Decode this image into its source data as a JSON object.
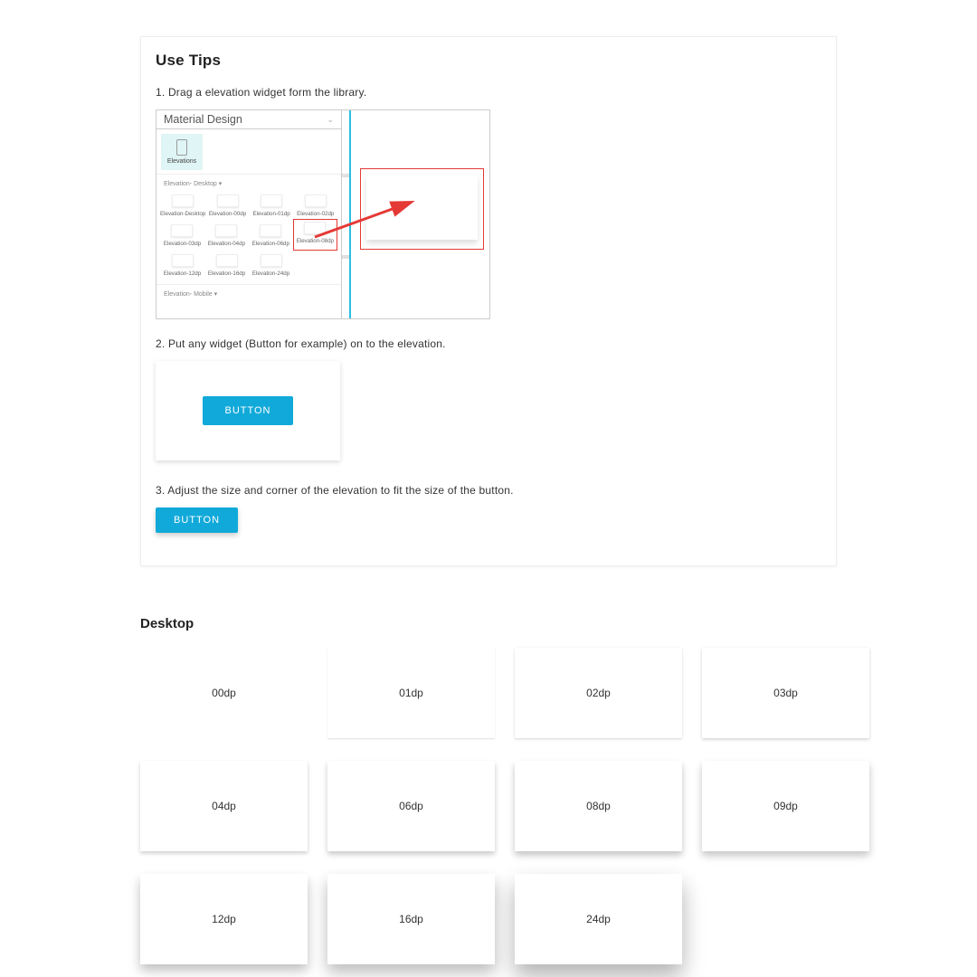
{
  "tips": {
    "title": "Use Tips",
    "step1": "1. Drag a elevation widget form the library.",
    "step2": "2. Put any widget (Button for example) on to the elevation.",
    "step3": "3. Adjust the size and corner of the elevation to fit the size of the button."
  },
  "library": {
    "header": "Material Design",
    "tab": "Elevations",
    "section_desktop": "Elevation- Desktop ▾",
    "section_mobile": "Elevation- Mobile ▾",
    "thumbs_row1": [
      "Elevation-Desktop",
      "Elevation-00dp",
      "Elevation-01dp",
      "Elevation-02dp"
    ],
    "thumbs_row2": [
      "Elevation-03dp",
      "Elevation-04dp",
      "Elevation-06dp",
      "Elevation-08dp"
    ],
    "thumbs_row3": [
      "Elevation-12dp",
      "Elevation-16dp",
      "Elevation-24dp"
    ],
    "ruler_a": "600",
    "ruler_b": "800"
  },
  "button_label": "BUTTON",
  "desktop_section": "Desktop",
  "desktop_cards": [
    "00dp",
    "01dp",
    "02dp",
    "03dp",
    "04dp",
    "06dp",
    "08dp",
    "09dp",
    "12dp",
    "16dp",
    "24dp"
  ]
}
